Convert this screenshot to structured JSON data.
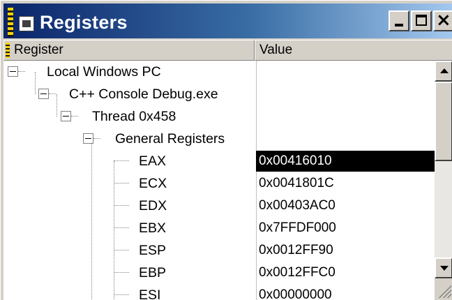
{
  "window": {
    "title": "Registers",
    "minimize_label": "_",
    "close_label": "×"
  },
  "columns": {
    "register": "Register",
    "value": "Value"
  },
  "tree": {
    "root": "Local Windows PC",
    "process": "C++ Console Debug.exe",
    "thread": "Thread 0x458",
    "group": "General Registers"
  },
  "registers": [
    {
      "name": "EAX",
      "value": "0x00416010",
      "selected": true
    },
    {
      "name": "ECX",
      "value": "0x0041801C"
    },
    {
      "name": "EDX",
      "value": "0x00403AC0"
    },
    {
      "name": "EBX",
      "value": "0x7FFDF000"
    },
    {
      "name": "ESP",
      "value": "0x0012FF90"
    },
    {
      "name": "EBP",
      "value": "0x0012FFC0"
    },
    {
      "name": "ESI",
      "value": "0x00000000"
    }
  ],
  "icons": {
    "window": "window-icon",
    "minimize": "minimize-icon",
    "maximize": "maximize-icon",
    "close": "close-icon",
    "scroll_up": "scroll-up-icon",
    "scroll_down": "scroll-down-icon"
  },
  "colors": {
    "titlebar_start": "#0a246a",
    "titlebar_end": "#a6caf0",
    "selection": "#000000",
    "grip_yellow": "#ffd200"
  }
}
